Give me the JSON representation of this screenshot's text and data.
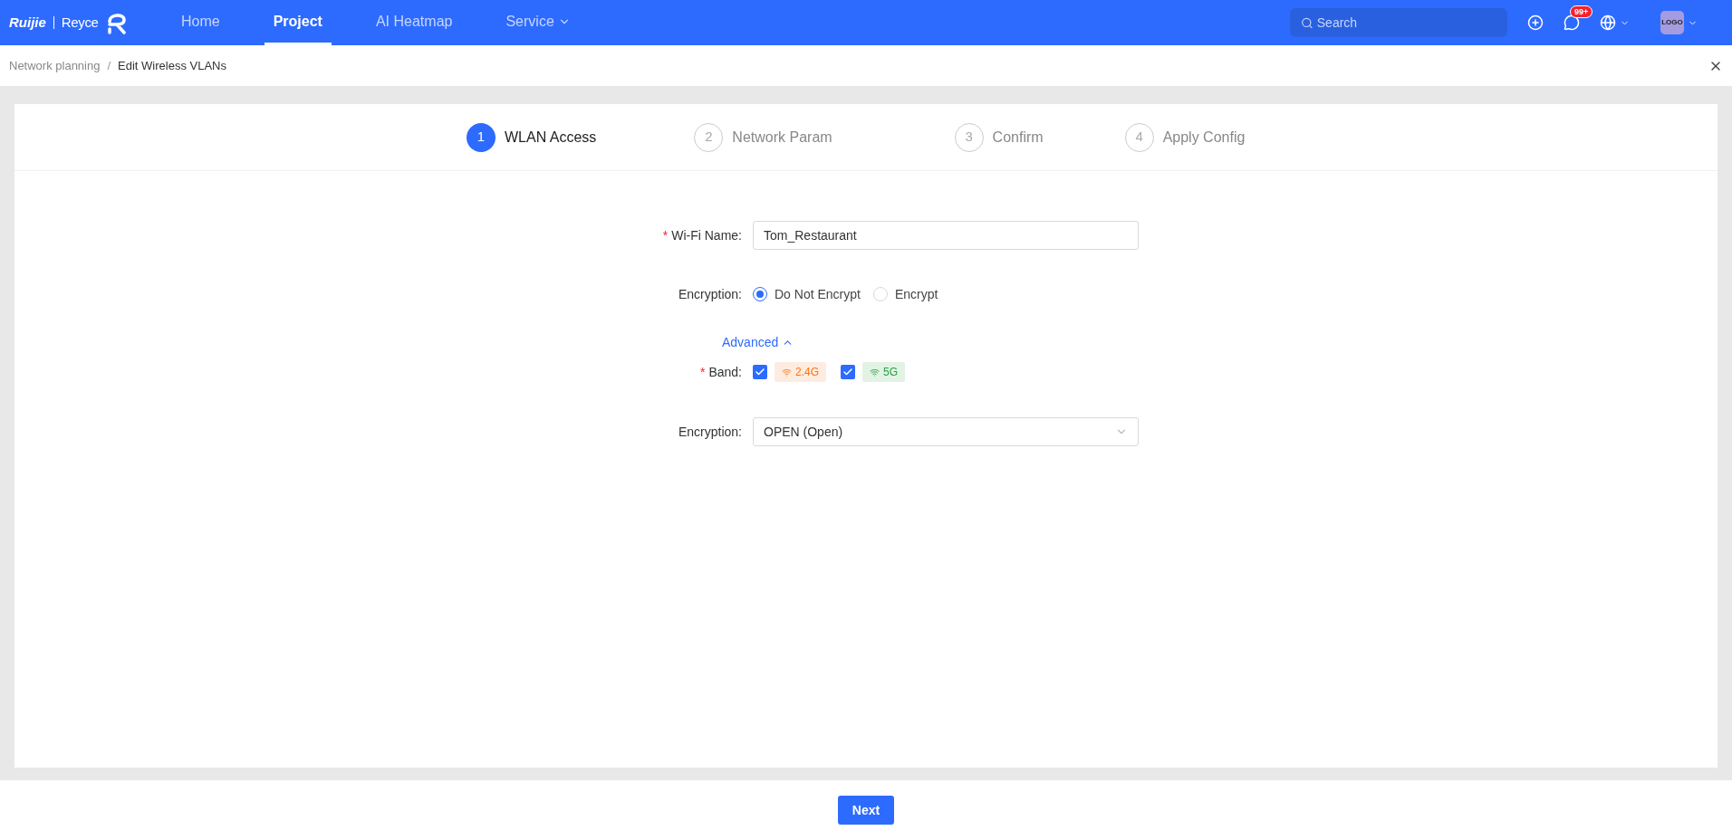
{
  "brand": {
    "name": "Ruijie",
    "product": "Reyce"
  },
  "nav": [
    {
      "label": "Home",
      "selected": false,
      "dropdown": false
    },
    {
      "label": "Project",
      "selected": true,
      "dropdown": false
    },
    {
      "label": "AI Heatmap",
      "selected": false,
      "dropdown": false
    },
    {
      "label": "Service",
      "selected": false,
      "dropdown": true
    }
  ],
  "search": {
    "placeholder": "Search"
  },
  "notifications": {
    "badge": "99+"
  },
  "avatar": {
    "label": "LOGO"
  },
  "breadcrumb": {
    "items": [
      "Network planning",
      "Edit Wireless VLANs"
    ],
    "separator": "/"
  },
  "steps": [
    {
      "number": "1",
      "label": "WLAN Access",
      "selected": true
    },
    {
      "number": "2",
      "label": "Network Param",
      "selected": false
    },
    {
      "number": "3",
      "label": "Confirm",
      "selected": false
    },
    {
      "number": "4",
      "label": "Apply Config",
      "selected": false
    }
  ],
  "form": {
    "wifi_name": {
      "label": "Wi-Fi Name:",
      "required_mark": "*",
      "value": "Tom_Restaurant"
    },
    "encryption_mode": {
      "label": "Encryption:",
      "options": [
        {
          "label": "Do Not Encrypt",
          "selected": true
        },
        {
          "label": "Encrypt",
          "selected": false
        }
      ]
    },
    "advanced": {
      "label": "Advanced",
      "expanded": true
    },
    "band": {
      "label": "Band:",
      "required_mark": "*",
      "options": [
        {
          "label": "2.4G",
          "checked": true,
          "color": "#f97316"
        },
        {
          "label": "5G",
          "checked": true,
          "color": "#22a33a"
        }
      ]
    },
    "encryption": {
      "label": "Encryption:",
      "value": "OPEN (Open)"
    }
  },
  "footer": {
    "button": "Next"
  }
}
